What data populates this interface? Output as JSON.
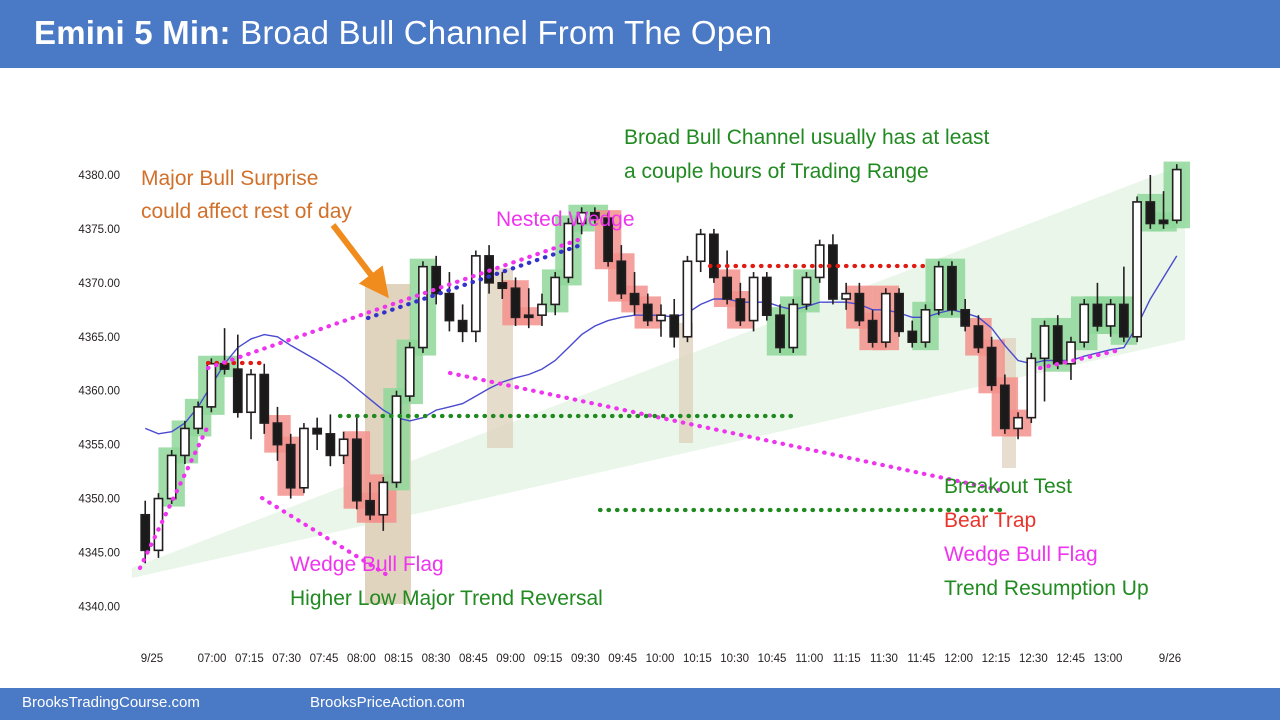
{
  "header": {
    "title_bold": "Emini 5 Min:",
    "title_rest": " Broad Bull Channel From The Open",
    "bg_color": "#4a79c6"
  },
  "footer": {
    "link1": "BrooksTradingCourse.com",
    "link2": "BrooksPriceAction.com"
  },
  "annotations": {
    "orange_1": "Major Bull Surprise",
    "orange_2": "could affect rest of day",
    "green_top_1": "Broad Bull Channel usually has at least",
    "green_top_2": "a couple hours of Trading Range",
    "nested_wedge": "Nested Wedge",
    "wedge_bull_flag_left": "Wedge Bull Flag",
    "higher_low": "Higher Low Major Trend Reversal",
    "breakout_test": "Breakout Test",
    "bear_trap": "Bear Trap",
    "wedge_bull_flag_right": "Wedge Bull Flag",
    "trend_resumption": "Trend Resumption Up"
  },
  "colors": {
    "bull_channel_fill": "#e9f6e9",
    "highlight_green": "#8fd79a",
    "highlight_red": "#f3908c",
    "surprise_band": "#ded0ba",
    "ema_blue": "#4a4ad0",
    "trendline_magenta": "#ef34ef",
    "trendline_blue": "#3333cc",
    "trendline_red": "#e01b12",
    "trendline_green": "#1f8a1f",
    "arrow_orange": "#f08c1e",
    "candle_outline": "#231f20"
  },
  "chart_data": {
    "type": "candlestick",
    "title": "Emini 5 Min: Broad Bull Channel From The Open",
    "ylabel": "",
    "xlabel": "",
    "ylim": [
      4338.0,
      4382.5
    ],
    "yticks": [
      "4340.00",
      "4345.00",
      "4350.00",
      "4355.00",
      "4360.00",
      "4365.00",
      "4370.00",
      "4375.00",
      "4380.00"
    ],
    "ytick_values": [
      4340,
      4345,
      4350,
      4355,
      4360,
      4365,
      4370,
      4375,
      4380
    ],
    "xticks": [
      "9/25",
      "07:00",
      "07:15",
      "07:30",
      "07:45",
      "08:00",
      "08:15",
      "08:30",
      "08:45",
      "09:00",
      "09:15",
      "09:30",
      "09:45",
      "10:00",
      "10:15",
      "10:30",
      "10:45",
      "11:00",
      "11:15",
      "11:30",
      "11:45",
      "12:00",
      "12:15",
      "12:30",
      "12:45",
      "13:00",
      "9/26"
    ],
    "grid": false,
    "legend": false,
    "candles": [
      {
        "i": 0,
        "o": 4348.5,
        "h": 4349.8,
        "l": 4344.0,
        "c": 4345.2,
        "dir": "down"
      },
      {
        "i": 1,
        "o": 4345.2,
        "h": 4350.5,
        "l": 4344.5,
        "c": 4350.0,
        "dir": "up"
      },
      {
        "i": 2,
        "o": 4350.0,
        "h": 4354.5,
        "l": 4349.5,
        "c": 4354.0,
        "dir": "up",
        "hl": "green"
      },
      {
        "i": 3,
        "o": 4354.0,
        "h": 4357.2,
        "l": 4353.2,
        "c": 4356.5,
        "dir": "up",
        "hl": "green"
      },
      {
        "i": 4,
        "o": 4356.5,
        "h": 4359.0,
        "l": 4356.0,
        "c": 4358.5,
        "dir": "up",
        "hl": "green"
      },
      {
        "i": 5,
        "o": 4358.5,
        "h": 4363.0,
        "l": 4358.0,
        "c": 4362.5,
        "dir": "up",
        "hl": "green"
      },
      {
        "i": 6,
        "o": 4362.5,
        "h": 4365.8,
        "l": 4361.5,
        "c": 4362.0,
        "dir": "down",
        "hl": "green"
      },
      {
        "i": 7,
        "o": 4362.0,
        "h": 4365.2,
        "l": 4357.5,
        "c": 4358.0,
        "dir": "down"
      },
      {
        "i": 8,
        "o": 4358.0,
        "h": 4362.0,
        "l": 4355.5,
        "c": 4361.5,
        "dir": "up"
      },
      {
        "i": 9,
        "o": 4361.5,
        "h": 4362.5,
        "l": 4356.0,
        "c": 4357.0,
        "dir": "down"
      },
      {
        "i": 10,
        "o": 4357.0,
        "h": 4358.5,
        "l": 4353.5,
        "c": 4355.0,
        "dir": "down",
        "hl": "red"
      },
      {
        "i": 11,
        "o": 4355.0,
        "h": 4356.0,
        "l": 4350.0,
        "c": 4351.0,
        "dir": "down",
        "hl": "red"
      },
      {
        "i": 12,
        "o": 4351.0,
        "h": 4357.0,
        "l": 4350.5,
        "c": 4356.5,
        "dir": "up"
      },
      {
        "i": 13,
        "o": 4356.5,
        "h": 4357.5,
        "l": 4354.5,
        "c": 4356.0,
        "dir": "down"
      },
      {
        "i": 14,
        "o": 4356.0,
        "h": 4357.8,
        "l": 4353.0,
        "c": 4354.0,
        "dir": "down"
      },
      {
        "i": 15,
        "o": 4354.0,
        "h": 4356.2,
        "l": 4353.2,
        "c": 4355.5,
        "dir": "up"
      },
      {
        "i": 16,
        "o": 4355.5,
        "h": 4357.5,
        "l": 4349.0,
        "c": 4349.8,
        "dir": "down",
        "hl": "red"
      },
      {
        "i": 17,
        "o": 4349.8,
        "h": 4351.5,
        "l": 4348.0,
        "c": 4348.5,
        "dir": "down",
        "hl": "red"
      },
      {
        "i": 18,
        "o": 4348.5,
        "h": 4352.0,
        "l": 4347.0,
        "c": 4351.5,
        "dir": "up",
        "hl": "red"
      },
      {
        "i": 19,
        "o": 4351.5,
        "h": 4360.0,
        "l": 4351.0,
        "c": 4359.5,
        "dir": "up",
        "hl": "green",
        "band": true
      },
      {
        "i": 20,
        "o": 4359.5,
        "h": 4364.5,
        "l": 4359.0,
        "c": 4364.0,
        "dir": "up",
        "hl": "green",
        "band": true
      },
      {
        "i": 21,
        "o": 4364.0,
        "h": 4372.0,
        "l": 4363.5,
        "c": 4371.5,
        "dir": "up",
        "hl": "green",
        "band": true
      },
      {
        "i": 22,
        "o": 4371.5,
        "h": 4372.5,
        "l": 4368.0,
        "c": 4369.0,
        "dir": "down"
      },
      {
        "i": 23,
        "o": 4369.0,
        "h": 4371.0,
        "l": 4365.5,
        "c": 4366.5,
        "dir": "down"
      },
      {
        "i": 24,
        "o": 4366.5,
        "h": 4368.0,
        "l": 4364.5,
        "c": 4365.5,
        "dir": "down"
      },
      {
        "i": 25,
        "o": 4365.5,
        "h": 4373.0,
        "l": 4364.5,
        "c": 4372.5,
        "dir": "up"
      },
      {
        "i": 26,
        "o": 4372.5,
        "h": 4373.5,
        "l": 4369.0,
        "c": 4370.0,
        "dir": "down",
        "band": true
      },
      {
        "i": 27,
        "o": 4370.0,
        "h": 4371.0,
        "l": 4368.5,
        "c": 4369.5,
        "dir": "down",
        "band": true
      },
      {
        "i": 28,
        "o": 4369.5,
        "h": 4370.5,
        "l": 4366.0,
        "c": 4366.8,
        "dir": "down",
        "hl": "red"
      },
      {
        "i": 29,
        "o": 4366.8,
        "h": 4369.5,
        "l": 4365.8,
        "c": 4367.0,
        "dir": "down",
        "hl": "red"
      },
      {
        "i": 30,
        "o": 4367.0,
        "h": 4369.0,
        "l": 4366.0,
        "c": 4368.0,
        "dir": "up"
      },
      {
        "i": 31,
        "o": 4368.0,
        "h": 4371.0,
        "l": 4367.0,
        "c": 4370.5,
        "dir": "up",
        "hl": "green"
      },
      {
        "i": 32,
        "o": 4370.5,
        "h": 4376.0,
        "l": 4370.0,
        "c": 4375.5,
        "dir": "up",
        "hl": "green"
      },
      {
        "i": 33,
        "o": 4375.5,
        "h": 4377.0,
        "l": 4374.5,
        "c": 4376.5,
        "dir": "up",
        "hl": "green"
      },
      {
        "i": 34,
        "o": 4376.5,
        "h": 4377.0,
        "l": 4375.5,
        "c": 4376.0,
        "dir": "down",
        "hl": "green"
      },
      {
        "i": 35,
        "o": 4376.0,
        "h": 4376.5,
        "l": 4371.5,
        "c": 4372.0,
        "dir": "down",
        "hl": "red"
      },
      {
        "i": 36,
        "o": 4372.0,
        "h": 4373.5,
        "l": 4368.5,
        "c": 4369.0,
        "dir": "down",
        "hl": "red"
      },
      {
        "i": 37,
        "o": 4369.0,
        "h": 4371.0,
        "l": 4367.0,
        "c": 4368.0,
        "dir": "down",
        "hl": "red"
      },
      {
        "i": 38,
        "o": 4368.0,
        "h": 4369.0,
        "l": 4366.0,
        "c": 4366.5,
        "dir": "down",
        "hl": "red"
      },
      {
        "i": 39,
        "o": 4366.5,
        "h": 4368.0,
        "l": 4365.0,
        "c": 4367.0,
        "dir": "up"
      },
      {
        "i": 40,
        "o": 4367.0,
        "h": 4368.5,
        "l": 4364.0,
        "c": 4365.0,
        "dir": "down",
        "band": true
      },
      {
        "i": 41,
        "o": 4365.0,
        "h": 4372.5,
        "l": 4364.5,
        "c": 4372.0,
        "dir": "up"
      },
      {
        "i": 42,
        "o": 4372.0,
        "h": 4375.0,
        "l": 4371.0,
        "c": 4374.5,
        "dir": "up"
      },
      {
        "i": 43,
        "o": 4374.5,
        "h": 4375.0,
        "l": 4370.0,
        "c": 4370.5,
        "dir": "down"
      },
      {
        "i": 44,
        "o": 4370.5,
        "h": 4373.0,
        "l": 4368.0,
        "c": 4368.5,
        "dir": "down",
        "hl": "red"
      },
      {
        "i": 45,
        "o": 4368.5,
        "h": 4370.0,
        "l": 4366.0,
        "c": 4366.5,
        "dir": "down",
        "hl": "red"
      },
      {
        "i": 46,
        "o": 4366.5,
        "h": 4371.0,
        "l": 4365.5,
        "c": 4370.5,
        "dir": "up"
      },
      {
        "i": 47,
        "o": 4370.5,
        "h": 4371.0,
        "l": 4366.5,
        "c": 4367.0,
        "dir": "down"
      },
      {
        "i": 48,
        "o": 4367.0,
        "h": 4368.0,
        "l": 4363.5,
        "c": 4364.0,
        "dir": "down",
        "hl": "green"
      },
      {
        "i": 49,
        "o": 4364.0,
        "h": 4368.5,
        "l": 4363.5,
        "c": 4368.0,
        "dir": "up",
        "hl": "green"
      },
      {
        "i": 50,
        "o": 4368.0,
        "h": 4371.0,
        "l": 4367.5,
        "c": 4370.5,
        "dir": "up",
        "hl": "green"
      },
      {
        "i": 51,
        "o": 4370.5,
        "h": 4374.0,
        "l": 4370.0,
        "c": 4373.5,
        "dir": "up"
      },
      {
        "i": 52,
        "o": 4373.5,
        "h": 4374.5,
        "l": 4368.0,
        "c": 4368.5,
        "dir": "down"
      },
      {
        "i": 53,
        "o": 4368.5,
        "h": 4370.0,
        "l": 4367.5,
        "c": 4369.0,
        "dir": "up"
      },
      {
        "i": 54,
        "o": 4369.0,
        "h": 4370.0,
        "l": 4366.0,
        "c": 4366.5,
        "dir": "down",
        "hl": "red"
      },
      {
        "i": 55,
        "o": 4366.5,
        "h": 4367.5,
        "l": 4364.0,
        "c": 4364.5,
        "dir": "down",
        "hl": "red"
      },
      {
        "i": 56,
        "o": 4364.5,
        "h": 4369.5,
        "l": 4364.0,
        "c": 4369.0,
        "dir": "up",
        "hl": "red"
      },
      {
        "i": 57,
        "o": 4369.0,
        "h": 4369.5,
        "l": 4365.0,
        "c": 4365.5,
        "dir": "down"
      },
      {
        "i": 58,
        "o": 4365.5,
        "h": 4366.5,
        "l": 4364.0,
        "c": 4364.5,
        "dir": "down"
      },
      {
        "i": 59,
        "o": 4364.5,
        "h": 4368.0,
        "l": 4364.0,
        "c": 4367.5,
        "dir": "up",
        "hl": "green"
      },
      {
        "i": 60,
        "o": 4367.5,
        "h": 4372.0,
        "l": 4367.0,
        "c": 4371.5,
        "dir": "up",
        "hl": "green"
      },
      {
        "i": 61,
        "o": 4371.5,
        "h": 4372.0,
        "l": 4367.0,
        "c": 4367.5,
        "dir": "down",
        "hl": "green"
      },
      {
        "i": 62,
        "o": 4367.5,
        "h": 4368.5,
        "l": 4365.5,
        "c": 4366.0,
        "dir": "down"
      },
      {
        "i": 63,
        "o": 4366.0,
        "h": 4367.0,
        "l": 4363.5,
        "c": 4364.0,
        "dir": "down",
        "hl": "red"
      },
      {
        "i": 64,
        "o": 4364.0,
        "h": 4365.0,
        "l": 4360.0,
        "c": 4360.5,
        "dir": "down",
        "hl": "red"
      },
      {
        "i": 65,
        "o": 4360.5,
        "h": 4361.5,
        "l": 4356.0,
        "c": 4356.5,
        "dir": "down",
        "hl": "red"
      },
      {
        "i": 66,
        "o": 4356.5,
        "h": 4358.0,
        "l": 4355.5,
        "c": 4357.5,
        "dir": "up",
        "hl": "red"
      },
      {
        "i": 67,
        "o": 4357.5,
        "h": 4363.5,
        "l": 4357.0,
        "c": 4363.0,
        "dir": "up"
      },
      {
        "i": 68,
        "o": 4363.0,
        "h": 4366.5,
        "l": 4359.0,
        "c": 4366.0,
        "dir": "up",
        "hl": "green"
      },
      {
        "i": 69,
        "o": 4366.0,
        "h": 4367.0,
        "l": 4362.0,
        "c": 4362.5,
        "dir": "down",
        "hl": "green"
      },
      {
        "i": 70,
        "o": 4362.5,
        "h": 4365.0,
        "l": 4361.0,
        "c": 4364.5,
        "dir": "up"
      },
      {
        "i": 71,
        "o": 4364.5,
        "h": 4368.5,
        "l": 4364.0,
        "c": 4368.0,
        "dir": "up",
        "hl": "green"
      },
      {
        "i": 72,
        "o": 4368.0,
        "h": 4370.0,
        "l": 4365.5,
        "c": 4366.0,
        "dir": "down",
        "hl": "green"
      },
      {
        "i": 73,
        "o": 4366.0,
        "h": 4368.5,
        "l": 4365.0,
        "c": 4368.0,
        "dir": "up",
        "hl": "green"
      },
      {
        "i": 74,
        "o": 4368.0,
        "h": 4371.5,
        "l": 4364.5,
        "c": 4365.0,
        "dir": "down",
        "hl": "green"
      },
      {
        "i": 75,
        "o": 4365.0,
        "h": 4378.0,
        "l": 4364.5,
        "c": 4377.5,
        "dir": "up"
      },
      {
        "i": 76,
        "o": 4377.5,
        "h": 4380.0,
        "l": 4375.0,
        "c": 4375.5,
        "dir": "down",
        "hl": "green"
      },
      {
        "i": 77,
        "o": 4375.5,
        "h": 4378.5,
        "l": 4375.0,
        "c": 4375.8,
        "dir": "down",
        "hl": "green"
      },
      {
        "i": 78,
        "o": 4375.8,
        "h": 4381.0,
        "l": 4375.5,
        "c": 4380.5,
        "dir": "up",
        "hl": "green"
      }
    ],
    "ema": [
      4356.5,
      4356.0,
      4356.2,
      4357.0,
      4358.5,
      4360.5,
      4362.5,
      4364.0,
      4364.8,
      4365.2,
      4365.0,
      4364.2,
      4363.5,
      4362.8,
      4362.0,
      4361.2,
      4360.2,
      4359.2,
      4358.2,
      4357.5,
      4357.2,
      4357.5,
      4358.2,
      4358.5,
      4358.8,
      4359.5,
      4360.2,
      4360.8,
      4361.2,
      4361.5,
      4362.0,
      4362.8,
      4364.0,
      4365.2,
      4366.0,
      4366.5,
      4366.8,
      4367.0,
      4367.0,
      4367.0,
      4366.8,
      4367.2,
      4368.0,
      4368.5,
      4368.5,
      4368.2,
      4368.2,
      4368.2,
      4367.8,
      4367.5,
      4367.8,
      4368.2,
      4368.2,
      4368.2,
      4368.0,
      4367.5,
      4367.5,
      4367.2,
      4366.8,
      4366.8,
      4367.2,
      4367.5,
      4367.2,
      4366.8,
      4365.8,
      4364.2,
      4362.8,
      4362.5,
      4362.8,
      4362.8,
      4362.8,
      4363.2,
      4363.5,
      4363.8,
      4364.0,
      4366.0,
      4368.5,
      4370.5,
      4372.5
    ],
    "trendlines": [
      {
        "name": "bull-channel-upper",
        "color": "#cfe8cf",
        "style": "band-edge"
      },
      {
        "name": "bull-channel-lower",
        "color": "#cfe8cf",
        "style": "band-edge"
      },
      {
        "name": "wedge-upper-magenta",
        "color": "#ef34ef",
        "style": "dotted"
      },
      {
        "name": "wedge-upper-blue",
        "color": "#3333cc",
        "style": "dotted"
      },
      {
        "name": "wedge-lower-magenta",
        "color": "#ef34ef",
        "style": "dotted"
      },
      {
        "name": "trading-range-high-red",
        "color": "#e01b12",
        "style": "dotted"
      },
      {
        "name": "trading-range-low-green",
        "color": "#1f8a1f",
        "style": "dotted"
      },
      {
        "name": "early-high-red",
        "color": "#e01b12",
        "style": "dotted"
      },
      {
        "name": "micro-wedge-magenta",
        "color": "#ef34ef",
        "style": "dotted"
      }
    ]
  }
}
